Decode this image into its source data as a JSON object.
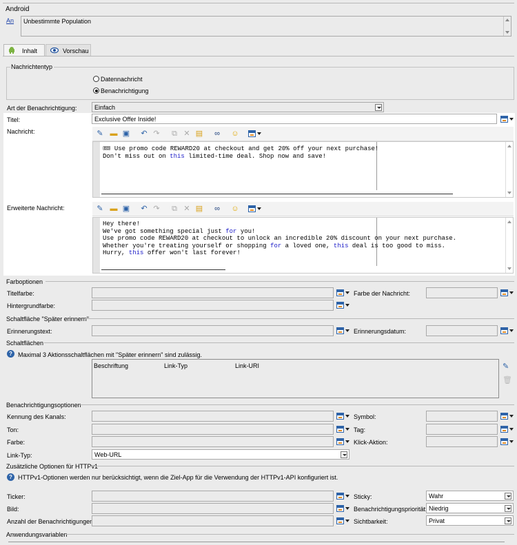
{
  "android": {
    "header": "Android",
    "link": "An",
    "population": "Unbestimmte Population"
  },
  "tabs": [
    {
      "label": "Inhalt",
      "icon": "android-icon",
      "active": true
    },
    {
      "label": "Vorschau",
      "icon": "eye-icon",
      "active": false
    }
  ],
  "message_type": {
    "header": "Nachrichtentyp",
    "options": [
      {
        "label": "Datennachricht",
        "selected": false
      },
      {
        "label": "Benachrichtigung",
        "selected": true
      }
    ]
  },
  "notification": {
    "type_label": "Art der Benachrichtigung:",
    "type_value": "Einfach",
    "title_label": "Titel:",
    "title_value": "Exclusive Offer Inside!",
    "message_label": "Nachricht:",
    "message_lines": [
      "🎟 Use promo code REWARD20 at checkout and get 20% off your next purchase!",
      "Don't miss out on this limited-time deal. Shop now and save!"
    ],
    "extended_label": "Erweiterte Nachricht:",
    "extended_lines": [
      "Hey there!",
      "We've got something special just for you!",
      "Use promo code REWARD20 at checkout to unlock an incredible 20% discount on your next purchase.",
      "Whether you're treating yourself or shopping for a loved one, this deal is too good to miss.",
      "Hurry, this offer won't last forever!"
    ]
  },
  "colors": {
    "header": "Farboptionen",
    "title_color": "Titelfarbe:",
    "message_color": "Farbe der Nachricht:",
    "background_color": "Hintergrundfarbe:"
  },
  "remind": {
    "header": "Schaltfläche \"Später erinnern\"",
    "text_label": "Erinnerungstext:",
    "date_label": "Erinnerungsdatum:"
  },
  "buttons": {
    "header": "Schaltflächen",
    "info": "Maximal 3 Aktionsschaltflächen mit \"Später erinnern\" sind zulässig.",
    "columns": [
      "Beschriftung",
      "Link-Typ",
      "Link-URI"
    ]
  },
  "options": {
    "header": "Benachrichtigungsoptionen",
    "channel": "Kennung des Kanals:",
    "symbol": "Symbol:",
    "sound": "Ton:",
    "tag": "Tag:",
    "color": "Farbe:",
    "click_action": "Klick-Aktion:",
    "link_type_label": "Link-Typ:",
    "link_type_value": "Web-URL"
  },
  "http": {
    "header": "Zusätzliche Optionen für HTTPv1",
    "info": "HTTPv1-Optionen werden nur berücksichtigt, wenn die Ziel-App für die Verwendung der HTTPv1-API konfiguriert ist.",
    "ticker": "Ticker:",
    "sticky_label": "Sticky:",
    "sticky_value": "Wahr",
    "image": "Bild:",
    "priority_label": "Benachrichtigungspriorität:",
    "priority_value": "Niedrig",
    "count": "Anzahl der Benachrichtigungen:",
    "visibility_label": "Sichtbarkeit:",
    "visibility_value": "Privat"
  },
  "app_vars": {
    "header": "Anwendungsvariablen"
  }
}
